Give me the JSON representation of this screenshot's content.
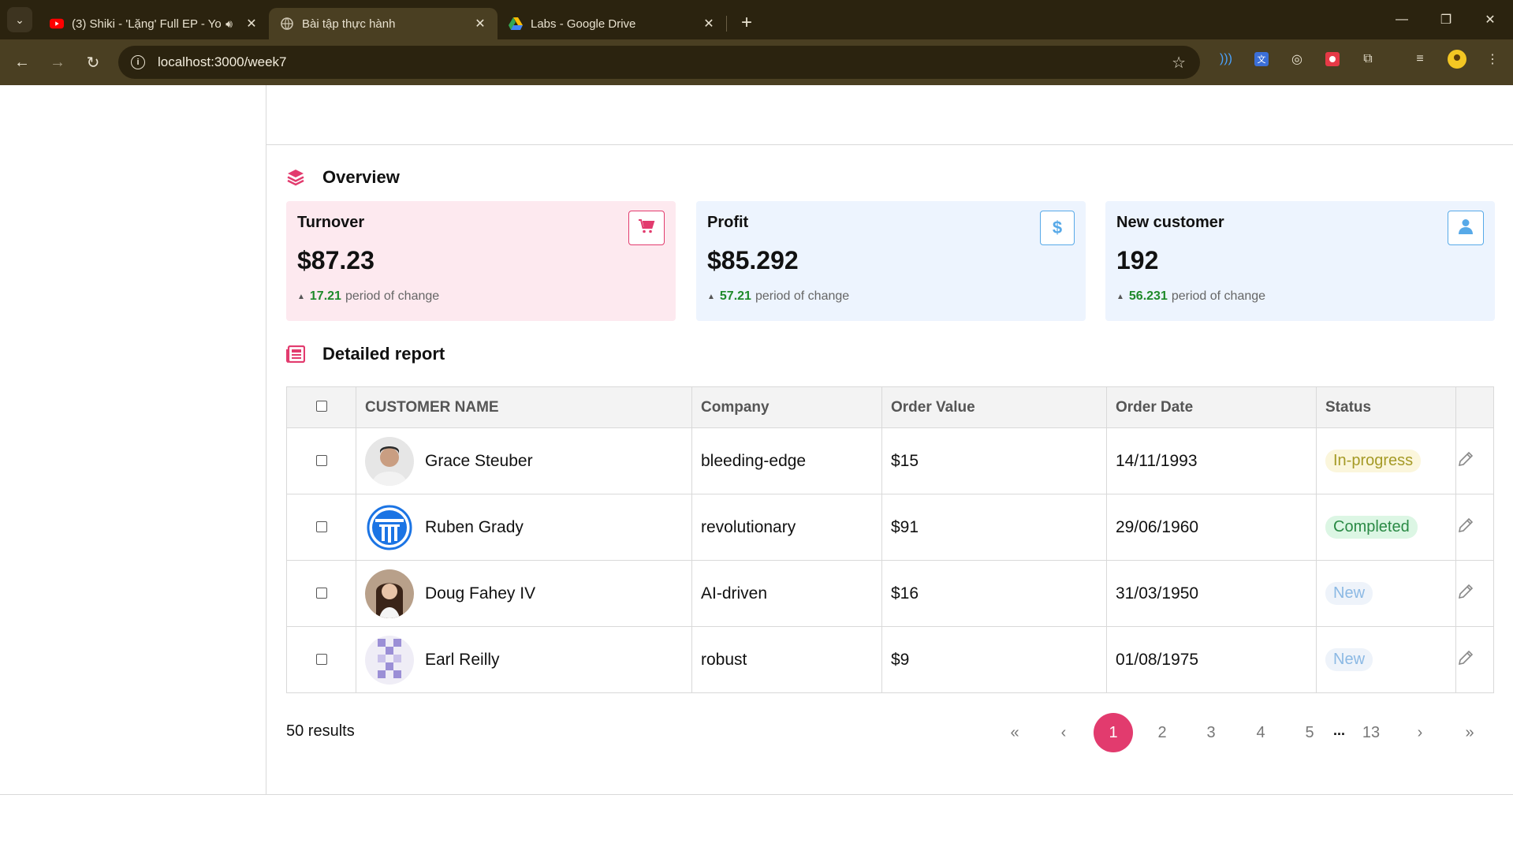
{
  "browser": {
    "tabs": [
      {
        "title": "(3) Shiki - 'Lặng' Full EP - Yo",
        "favicon": "youtube-icon"
      },
      {
        "title": "Bài tập thực hành",
        "favicon": "globe-icon"
      },
      {
        "title": "Labs - Google Drive",
        "favicon": "google-drive-icon"
      }
    ],
    "url": "localhost:3000/week7"
  },
  "overview": {
    "title": "Overview",
    "cards": [
      {
        "title": "Turnover",
        "value": "$87.23",
        "change": "17.21",
        "change_label": "period of change",
        "icon": "cart-icon",
        "color": "#fde9ef"
      },
      {
        "title": "Profit",
        "value": "$85.292",
        "change": "57.21",
        "change_label": "period of change",
        "icon": "dollar-icon",
        "color": "#edf4fe"
      },
      {
        "title": "New customer",
        "value": "192",
        "change": "56.231",
        "change_label": "period of change",
        "icon": "user-icon",
        "color": "#edf4fe"
      }
    ]
  },
  "report": {
    "title": "Detailed report",
    "columns": [
      "CUSTOMER NAME",
      "Company",
      "Order Value",
      "Order Date",
      "Status"
    ],
    "rows": [
      {
        "name": "Grace Steuber",
        "company": "bleeding-edge",
        "value": "$15",
        "date": "14/11/1993",
        "status": "In-progress"
      },
      {
        "name": "Ruben Grady",
        "company": "revolutionary",
        "value": "$91",
        "date": "29/06/1960",
        "status": "Completed"
      },
      {
        "name": "Doug Fahey IV",
        "company": "AI-driven",
        "value": "$16",
        "date": "31/03/1950",
        "status": "New"
      },
      {
        "name": "Earl Reilly",
        "company": "robust",
        "value": "$9",
        "date": "01/08/1975",
        "status": "New"
      }
    ]
  },
  "pagination": {
    "results": "50 results",
    "first": "«",
    "prev": "‹",
    "pages": [
      "1",
      "2",
      "3",
      "4",
      "5"
    ],
    "dots": "...",
    "last_page": "13",
    "next": "›",
    "last": "»",
    "current": "1"
  },
  "colors": {
    "accent": "#e23b6e",
    "success": "#1f8a2b"
  }
}
